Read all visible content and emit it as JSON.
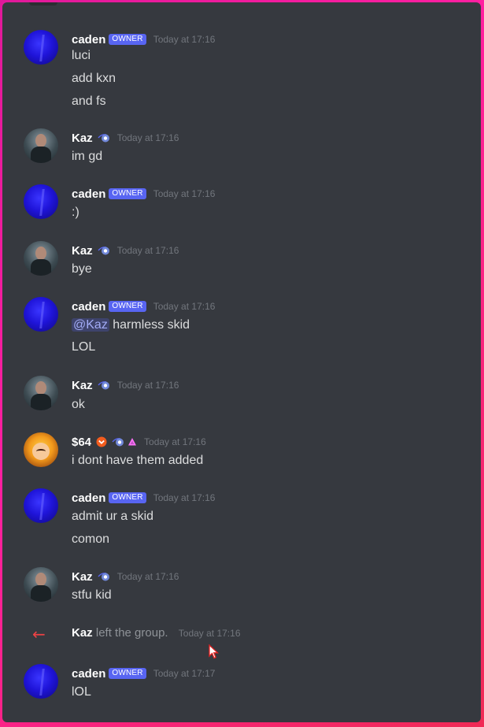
{
  "messages": [
    {
      "user": "caden",
      "badge": "OWNER",
      "time": "Today at 17:16",
      "lines": [
        "luci",
        "add kxn",
        "and fs"
      ]
    },
    {
      "user": "Kaz",
      "time": "Today at 17:16",
      "lines": [
        "im gd"
      ]
    },
    {
      "user": "caden",
      "badge": "OWNER",
      "time": "Today at 17:16",
      "lines": [
        ":)"
      ]
    },
    {
      "user": "Kaz",
      "time": "Today at 17:16",
      "lines": [
        "bye"
      ]
    },
    {
      "user": "caden",
      "badge": "OWNER",
      "time": "Today at 17:16",
      "mention": "@Kaz",
      "mention_rest": " harmless skid",
      "lines": [
        "LOL"
      ]
    },
    {
      "user": "Kaz",
      "time": "Today at 17:16",
      "lines": [
        "ok"
      ]
    },
    {
      "user": "$64",
      "time": "Today at 17:16",
      "lines": [
        "i dont have them added"
      ]
    },
    {
      "user": "caden",
      "badge": "OWNER",
      "time": "Today at 17:16",
      "lines": [
        "admit ur a skid",
        "comon"
      ]
    },
    {
      "user": "Kaz",
      "time": "Today at 17:16",
      "lines": [
        "stfu kid"
      ]
    },
    {
      "user": "caden",
      "badge": "OWNER",
      "time": "Today at 17:17",
      "lines": [
        "lOL"
      ]
    }
  ],
  "system": {
    "arrow": "←",
    "user": "Kaz",
    "text": " left the group.",
    "time": "Today at 17:16"
  },
  "colors": {
    "background": "#36393f",
    "owner_badge": "#5865f2",
    "leave_arrow": "#ed4245",
    "mention": "#a3acf7"
  },
  "icons": {
    "kaz_badge": "hypesquad-icon",
    "s64_badges": [
      "chevron-badge-icon",
      "hypesquad-icon",
      "nitro-triangle-icon"
    ]
  }
}
